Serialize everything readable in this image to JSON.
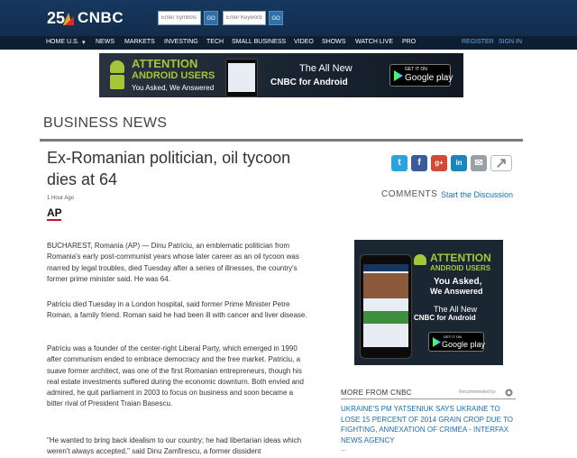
{
  "header": {
    "logo_badge": "25",
    "logo_text": "CNBC",
    "symbol_placeholder": "Enter Symbols",
    "keyword_placeholder": "Enter Keywords",
    "go_label": "GO"
  },
  "nav": {
    "items": [
      "HOME U.S.",
      "▾",
      "NEWS",
      "MARKETS",
      "INVESTING",
      "TECH",
      "SMALL BUSINESS",
      "VIDEO",
      "SHOWS",
      "WATCH LIVE",
      "PRO"
    ],
    "register": "REGISTER",
    "sign_in": "SIGN IN"
  },
  "top_banner": {
    "attention": "ATTENTION",
    "android_users": "ANDROID USERS",
    "tagline": "You Asked, We Answered",
    "all_new": "The All New",
    "cnbc_for_android": "CNBC for Android",
    "get_it_on": "GET IT ON",
    "google_play": "Google play"
  },
  "section_title": "BUSINESS NEWS",
  "article": {
    "headline": "Ex-Romanian politician, oil tycoon dies at 64",
    "time_ago": "1 Hour Ago",
    "source": "AP",
    "paragraphs": [
      "BUCHAREST, Romania (AP) — Dinu Patriciu, an emblematic politician from Romania's early post-communist years whose later career as an oil tycoon was marred by legal troubles, died Tuesday after a series of illnesses, the country's former prime minister said. He was 64.",
      "Patriciu died Tuesday in a London hospital, said former Prime Minister Petre Roman, a family friend. Roman said he had been ill with cancer and liver disease.",
      "Patriciu was a founder of the center-right Liberal Party, which emerged in 1990 after communism ended to embrace democracy and the free market. Patriciu, a suave former architect, was one of the first Romanian entrepreneurs, though his real estate investments suffered during the economic downturn. Both envied and admired, he quit parliament in 2003 to focus on business and soon became a bitter rival of President Traian Basescu.",
      "\"He wanted to bring back idealism to our country; he had libertarian ideas which weren't always accepted,\" said Dinu Zamfirescu, a former dissident"
    ]
  },
  "share": {
    "twitter": "t",
    "facebook": "f",
    "google_plus": "g+",
    "linkedin": "in",
    "email": "✉",
    "share": "↗"
  },
  "comments": {
    "label": "COMMENTS",
    "link": "Start the Discussion"
  },
  "side_ad": {
    "attention": "ATTENTION",
    "android_users": "ANDROID USERS",
    "you_asked": "You Asked,",
    "we_answered": "We Answered",
    "all_new": "The All New",
    "cnbc_for_android": "CNBC for Android",
    "get_it_on": "GET IT ON",
    "google_play": "Google play"
  },
  "more": {
    "title": "MORE FROM CNBC",
    "recommended": "Recommended by",
    "links": [
      "Ukraine's PM Yatseniuk says Ukraine to lose 15 percent of 2014 grain crop due to fighting, annexation of Crimea - Interfax News Agency",
      "..."
    ]
  },
  "colors": {
    "header_bg": "#17385f",
    "nav_bg": "#0e1f33",
    "link": "#1a6fb0",
    "android_green": "#a4c639",
    "ap_red": "#c8102e"
  }
}
